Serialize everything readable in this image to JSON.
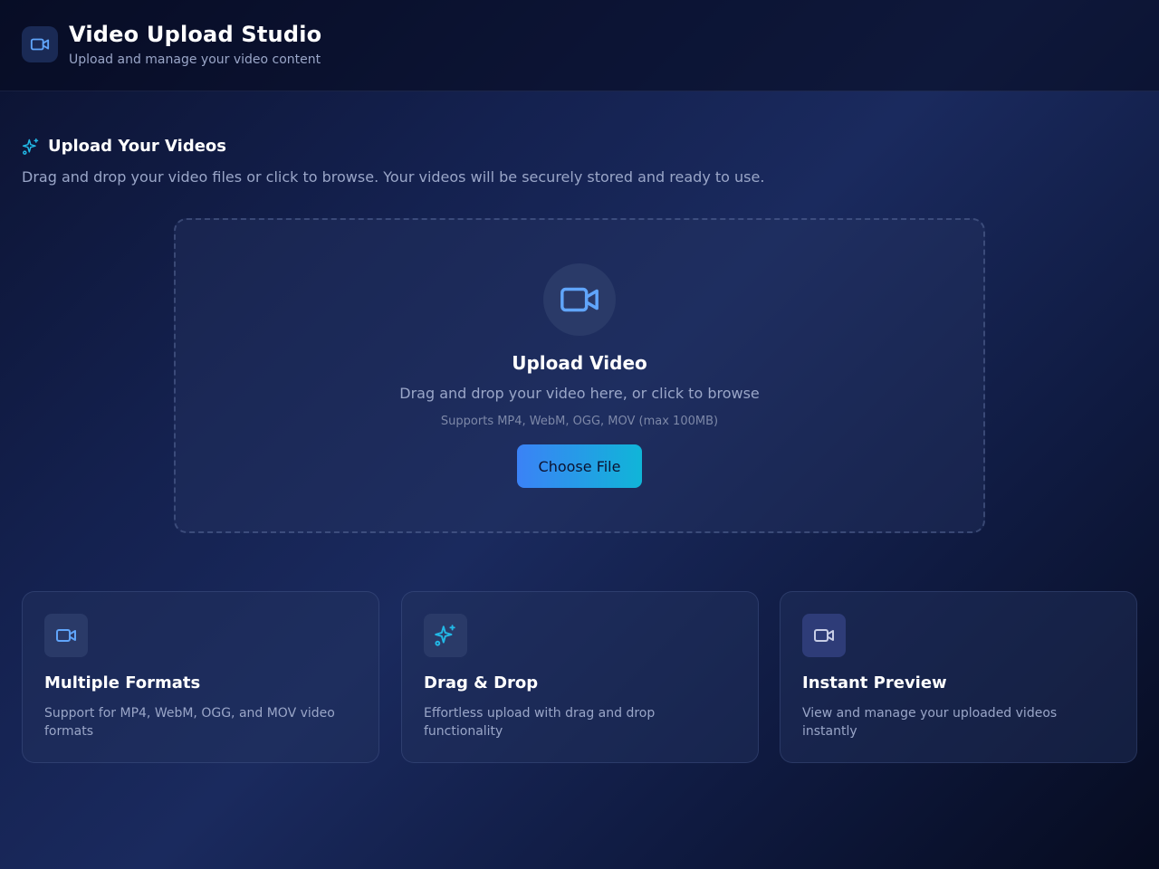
{
  "header": {
    "title": "Video Upload Studio",
    "subtitle": "Upload and manage your video content",
    "logo_icon": "video-camera-icon"
  },
  "section": {
    "title": "Upload Your Videos",
    "title_icon": "sparkles-icon",
    "description": "Drag and drop your video files or click to browse. Your videos will be securely stored and ready to use."
  },
  "dropzone": {
    "icon": "video-camera-icon",
    "title": "Upload Video",
    "description": "Drag and drop your video here, or click to browse",
    "hint": "Supports MP4, WebM, OGG, MOV (max 100MB)",
    "button_label": "Choose File"
  },
  "features": [
    {
      "icon": "video-camera-icon",
      "title": "Multiple Formats",
      "description": "Support for MP4, WebM, OGG, and MOV video formats"
    },
    {
      "icon": "sparkles-icon",
      "title": "Drag & Drop",
      "description": "Effortless upload with drag and drop functionality"
    },
    {
      "icon": "video-camera-icon",
      "title": "Instant Preview",
      "description": "View and manage your uploaded videos instantly"
    }
  ],
  "colors": {
    "accent_blue": "#60a5fa",
    "accent_cyan": "#22b8e6",
    "button_gradient_start": "#3b82f6",
    "button_gradient_end": "#10b5d8",
    "muted_text": "#9aa6c8"
  }
}
